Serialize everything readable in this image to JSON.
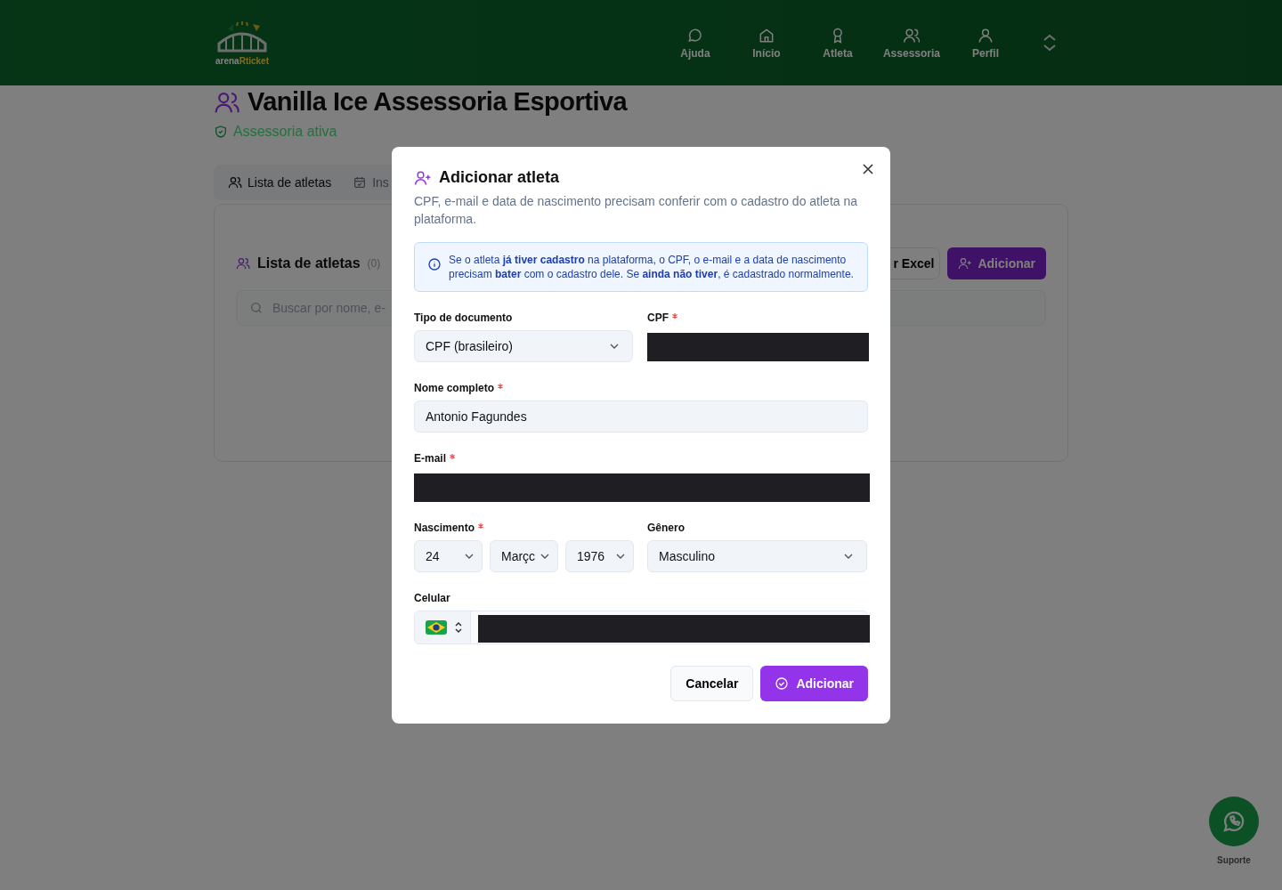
{
  "header": {
    "logo": {
      "left": "arena",
      "right": "Rticket"
    },
    "nav": [
      {
        "label": "Ajuda"
      },
      {
        "label": "Início"
      },
      {
        "label": "Atleta"
      },
      {
        "label": "Assessoria"
      },
      {
        "label": "Perfil"
      }
    ]
  },
  "page": {
    "title": "Vanilla Ice Assessoria Esportiva",
    "status": "Assessoria ativa",
    "tabs": [
      {
        "label": "Lista de atletas",
        "selected": true
      },
      {
        "label": "Ins",
        "selected": false
      }
    ],
    "card": {
      "title": "Lista de atletas",
      "count": "(0)",
      "excel_button": "r Excel",
      "add_button": "Adicionar",
      "search_placeholder": "Buscar por nome, e-"
    }
  },
  "modal": {
    "title": "Adicionar atleta",
    "description": "CPF, e-mail e data de nascimento precisam conferir com o cadastro do atleta na plataforma.",
    "info": "Se o atleta **já tiver cadastro** na plataforma, o CPF, o e-mail e a data de nascimento precisam **bater** com o cadastro dele. Se **ainda não tiver**, é cadastrado normalmente.",
    "document_type": {
      "label": "Tipo de documento",
      "value": "CPF (brasileiro)"
    },
    "cpf": {
      "label": "CPF",
      "required": true
    },
    "name": {
      "label": "Nome completo",
      "required": true,
      "value": "Antonio Fagundes"
    },
    "email": {
      "label": "E-mail",
      "required": true
    },
    "birth": {
      "label": "Nascimento",
      "required": true,
      "day": "24",
      "month": "Marçc",
      "year": "1976"
    },
    "gender": {
      "label": "Gênero",
      "value": "Masculino"
    },
    "phone": {
      "label": "Celular"
    },
    "cancel": "Cancelar",
    "submit": "Adicionar"
  },
  "support": {
    "label": "Suporte"
  }
}
